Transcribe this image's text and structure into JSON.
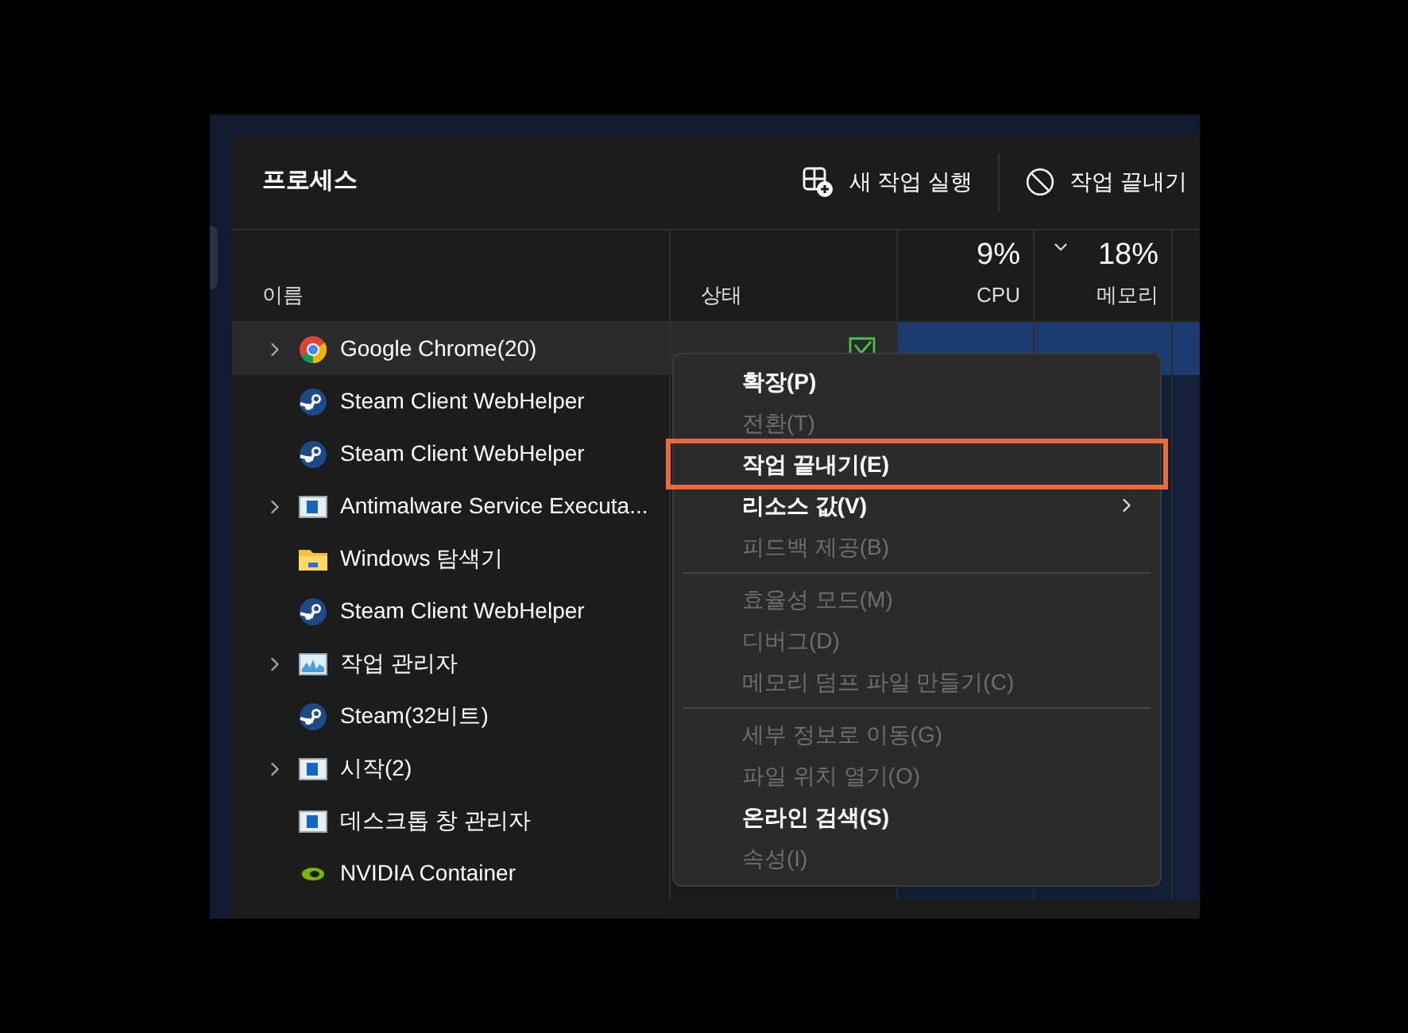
{
  "header": {
    "title": "프로세스",
    "buttons": [
      {
        "label": "새 작업 실행",
        "kind": "new-task"
      },
      {
        "label": "작업 끝내기",
        "kind": "end-task"
      }
    ]
  },
  "table": {
    "columns": [
      {
        "label": "이름"
      },
      {
        "label": "상태"
      },
      {
        "percent": "9%",
        "label": "CPU",
        "sorted": false
      },
      {
        "percent": "18%",
        "label": "메모리",
        "sorted": true
      }
    ],
    "rows": [
      {
        "name": "Google Chrome(20)",
        "kind": "chrome",
        "expandable": true,
        "selected": true,
        "efficiency_mode": true
      },
      {
        "name": "Steam Client WebHelper",
        "kind": "steam",
        "expandable": false,
        "selected": false
      },
      {
        "name": "Steam Client WebHelper",
        "kind": "steam",
        "expandable": false,
        "selected": false
      },
      {
        "name": "Antimalware Service Executa...",
        "kind": "app",
        "expandable": true,
        "selected": false
      },
      {
        "name": "Windows 탐색기",
        "kind": "folder",
        "expandable": false,
        "selected": false
      },
      {
        "name": "Steam Client WebHelper",
        "kind": "steam",
        "expandable": false,
        "selected": false
      },
      {
        "name": "작업 관리자",
        "kind": "monitor",
        "expandable": true,
        "selected": false
      },
      {
        "name": "Steam(32비트)",
        "kind": "steam",
        "expandable": false,
        "selected": false
      },
      {
        "name": "시작(2)",
        "kind": "app",
        "expandable": true,
        "selected": false
      },
      {
        "name": "데스크톱 창 관리자",
        "kind": "app",
        "expandable": false,
        "selected": false
      },
      {
        "name": "NVIDIA Container",
        "kind": "nvidia",
        "expandable": false,
        "selected": false
      }
    ]
  },
  "context_menu": {
    "items": [
      {
        "kind": "item",
        "label": "확장(P)",
        "disabled": false,
        "highlighted": false,
        "submenu": false
      },
      {
        "kind": "item",
        "label": "전환(T)",
        "disabled": true,
        "highlighted": false,
        "submenu": false
      },
      {
        "kind": "item",
        "label": "작업 끝내기(E)",
        "disabled": false,
        "highlighted": true,
        "submenu": false
      },
      {
        "kind": "item",
        "label": "리소스 값(V)",
        "disabled": false,
        "highlighted": false,
        "submenu": true
      },
      {
        "kind": "item",
        "label": "피드백 제공(B)",
        "disabled": true,
        "highlighted": false,
        "submenu": false
      },
      {
        "kind": "separator"
      },
      {
        "kind": "item",
        "label": "효율성 모드(M)",
        "disabled": true,
        "highlighted": false,
        "submenu": false
      },
      {
        "kind": "item",
        "label": "디버그(D)",
        "disabled": true,
        "highlighted": false,
        "submenu": false
      },
      {
        "kind": "item",
        "label": "메모리 덤프 파일 만들기(C)",
        "disabled": true,
        "highlighted": false,
        "submenu": false
      },
      {
        "kind": "separator"
      },
      {
        "kind": "item",
        "label": "세부 정보로 이동(G)",
        "disabled": true,
        "highlighted": false,
        "submenu": false
      },
      {
        "kind": "item",
        "label": "파일 위치 열기(O)",
        "disabled": true,
        "highlighted": false,
        "submenu": false
      },
      {
        "kind": "item",
        "label": "온라인 검색(S)",
        "disabled": false,
        "highlighted": false,
        "submenu": false
      },
      {
        "kind": "item",
        "label": "속성(I)",
        "disabled": true,
        "highlighted": false,
        "submenu": false
      }
    ]
  }
}
